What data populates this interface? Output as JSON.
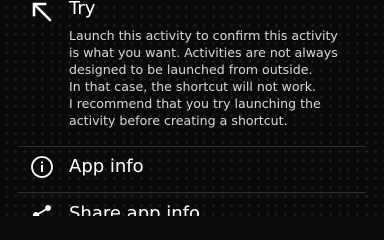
{
  "menu": {
    "try": {
      "title": "Try",
      "icon": "arrow-up-left-icon",
      "description_lines": [
        "Launch this activity to confirm this activity",
        "is what you want. Activities are not always",
        "designed to be launched from outside.",
        "In that case, the shortcut will not work.",
        "I recommend that you try launching the",
        "activity before creating a shortcut."
      ]
    },
    "app_info": {
      "title": "App info",
      "icon": "info-icon"
    },
    "share_app_info": {
      "title": "Share app info",
      "icon": "share-icon"
    }
  },
  "colors": {
    "background": "#0a0a0a",
    "text": "#ffffff",
    "secondary_text": "#d6d6d6",
    "divider": "#2e2e2e"
  }
}
